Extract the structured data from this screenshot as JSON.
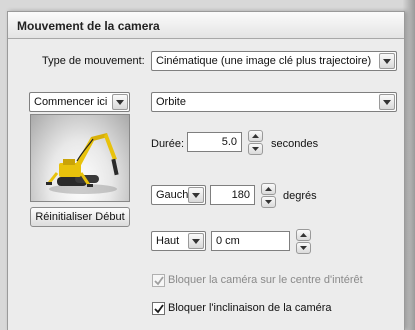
{
  "section": {
    "title": "Mouvement de la camera"
  },
  "movement_type": {
    "label": "Type de mouvement:",
    "value": "Cinématique (une image clé plus trajectoire)"
  },
  "start_select": {
    "value": "Commencer ici"
  },
  "path_select": {
    "value": "Orbite"
  },
  "duration": {
    "label": "Durée:",
    "value": "5.0",
    "unit": "secondes"
  },
  "direction": {
    "value": "Gauch",
    "angle": "180",
    "unit": "degrés"
  },
  "vertical": {
    "value": "Haut",
    "distance": "0 cm"
  },
  "reset_button": {
    "label": "Réinitialiser Début"
  },
  "options": {
    "lock_center": {
      "label": "Bloquer la caméra sur le centre d'intérêt",
      "checked": true,
      "enabled": false
    },
    "lock_tilt": {
      "label": "Bloquer l'inclinaison de la caméra",
      "checked": true,
      "enabled": true
    }
  },
  "icons": {
    "dropdown": "chevron-down-icon",
    "spin_up": "spin-up-icon",
    "spin_down": "spin-down-icon",
    "check": "check-icon",
    "preview": "excavator-preview-icon"
  },
  "colors": {
    "panel_bg": "#ececec",
    "machine_yellow": "#e8c20c",
    "machine_dark": "#2a2a2a"
  }
}
